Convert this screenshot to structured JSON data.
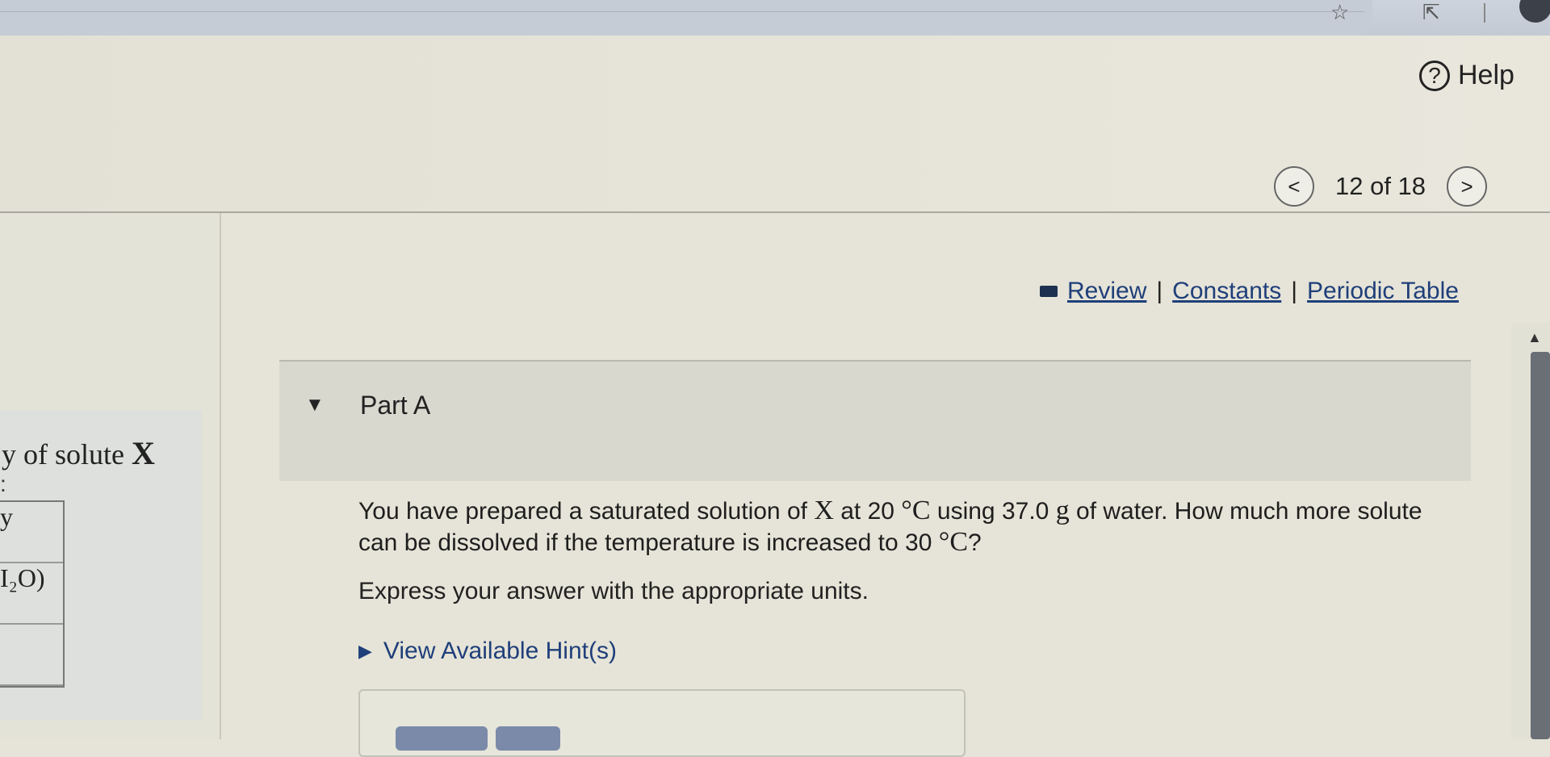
{
  "header": {
    "help_label": "Help",
    "help_symbol": "?",
    "nav_prev_symbol": "<",
    "nav_next_symbol": ">",
    "page_counter": "12 of 18"
  },
  "links": {
    "review": "Review",
    "constants": "Constants",
    "periodic_table": "Periodic Table",
    "separator": "|"
  },
  "left_panel": {
    "title_text": "y of solute ",
    "title_symbol": "X",
    "colon": ":",
    "table_rows": [
      "y",
      "I₂O)",
      "",
      ""
    ]
  },
  "part": {
    "label": "Part A"
  },
  "question": {
    "line1_a": "You have prepared a saturated solution of ",
    "symbol_x": "X",
    "line1_b": " at 20 ",
    "deg_c1": "°C",
    "line1_c": " using 37.0 ",
    "unit_g": "g",
    "line1_d": " of water. How much more solute can be dissolved if the temperature is increased to 30 ",
    "deg_c2": "°C",
    "line1_e": "?",
    "instruction": "Express your answer with the appropriate units.",
    "hint_label": "View Available Hint(s)"
  },
  "colors": {
    "link": "#1f3f7a",
    "background": "#e6e4d8",
    "part_bar": "#d8d8cf"
  }
}
